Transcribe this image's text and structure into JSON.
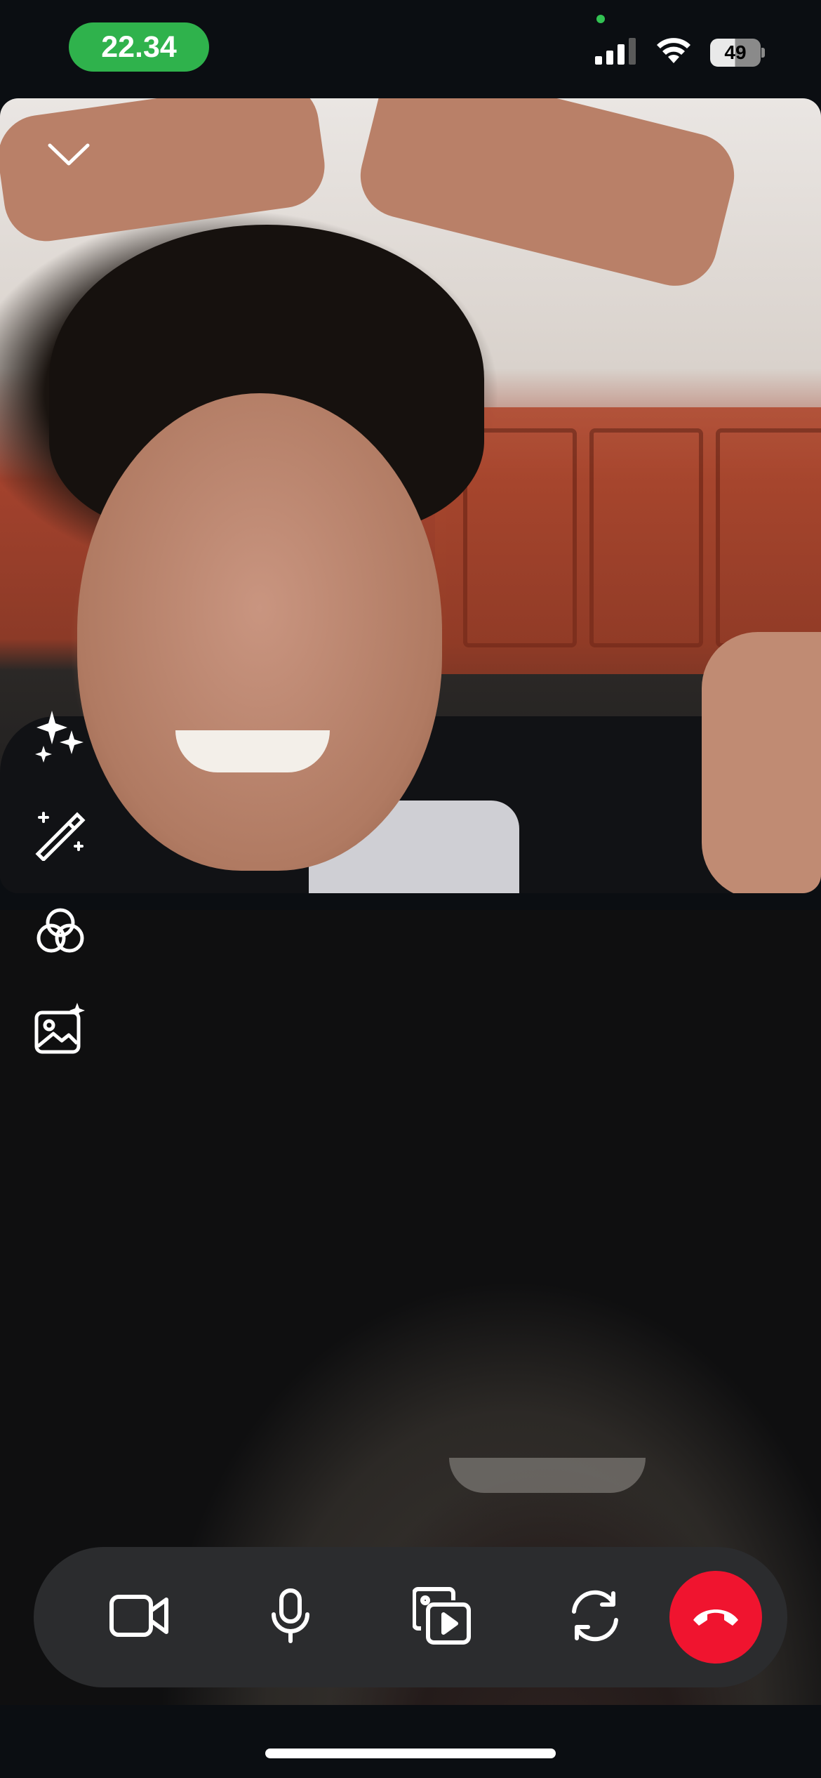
{
  "status_bar": {
    "time": "22.34",
    "battery_percent": "49",
    "cellular_icon": "cellular-signal-icon",
    "wifi_icon": "wifi-icon",
    "camera_indicator_color": "#32c252"
  },
  "call": {
    "remote_video_label": "remote-participant-video",
    "local_video_label": "self-view-video",
    "collapse_icon": "chevron-down-icon"
  },
  "effects_rail": [
    {
      "icon": "sparkles-icon"
    },
    {
      "icon": "magic-wand-icon"
    },
    {
      "icon": "color-filter-icon"
    },
    {
      "icon": "background-image-icon"
    }
  ],
  "controls": [
    {
      "icon": "video-camera-icon"
    },
    {
      "icon": "microphone-icon"
    },
    {
      "icon": "share-media-icon"
    },
    {
      "icon": "flip-camera-icon"
    },
    {
      "icon": "end-call-icon"
    }
  ],
  "colors": {
    "time_pill": "#2fb24c",
    "end_call": "#f0142f",
    "control_bar": "#2b2c2e"
  }
}
